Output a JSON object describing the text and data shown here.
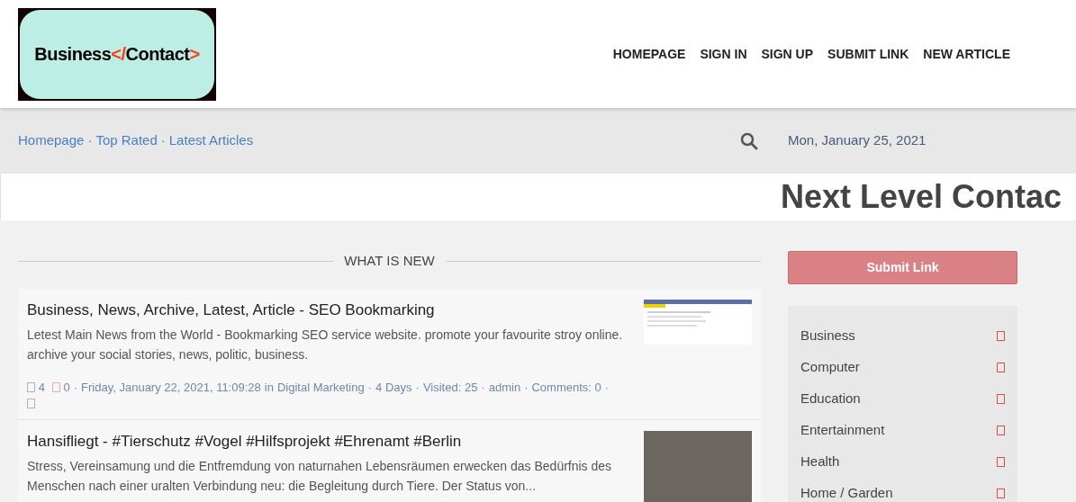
{
  "logo": {
    "parts": [
      {
        "text": "Business",
        "color": "#000000"
      },
      {
        "text": "</",
        "color": "#ff3c14"
      },
      {
        "text": "Contact",
        "color": "#000000"
      },
      {
        "text": ">",
        "color": "#ff3c14"
      }
    ]
  },
  "nav": [
    "HOMEPAGE",
    "SIGN IN",
    "SIGN UP",
    "SUBMIT LINK",
    "NEW ARTICLE"
  ],
  "breadcrumbs": [
    "Homepage",
    "Top Rated",
    "Latest Articles"
  ],
  "separator": "·",
  "date": "Mon, January 25, 2021",
  "headline": "Next Level Contac",
  "section_title": "WHAT IS NEW",
  "articles": [
    {
      "title": "Business, News, Archive, Latest, Article - SEO Bookmarking",
      "summary": "Letest Main News from the World - Bookmarking SEO service website. promote your favourite stroy online. archive your social stories, news, politic, business.",
      "kind": "screenshot",
      "meta": {
        "up": "4",
        "down": "0",
        "date": "Friday, January 22, 2021, 11:09:28",
        "in": "in",
        "category": "Digital Marketing",
        "age": "4 Days",
        "visited": "Visited: 25",
        "author": "admin",
        "comments": "Comments: 0"
      }
    },
    {
      "title": "Hansifliegt - #Tierschutz #Vogel #Hilfsprojekt #Ehrenamt #Berlin",
      "summary": "Stress, Vereinsamung und die Entfremdung von naturnahen Lebensräumen erwecken das Bedürfnis des Menschen nach einer uralten Verbindung neu: die Begleitung durch Tiere. Der Status von...",
      "kind": "photo"
    }
  ],
  "submit_button": "Submit Link",
  "categories": [
    "Business",
    "Computer",
    "Education",
    "Entertainment",
    "Health",
    "Home / Garden"
  ]
}
